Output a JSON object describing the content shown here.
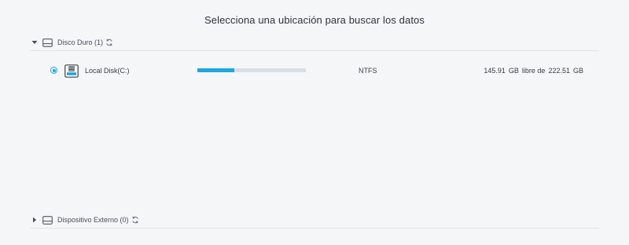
{
  "title": "Selecciona una ubicación para buscar los datos",
  "sections": [
    {
      "label": "Disco Duro (1)",
      "expanded": true,
      "drives": [
        {
          "name": "Local Disk(C:)",
          "selected": true,
          "filesystem": "NTFS",
          "free": "145.91",
          "free_unit": "GB",
          "free_label": "libre de",
          "total": "222.51",
          "total_unit": "GB",
          "used_fraction": 0.344
        }
      ]
    },
    {
      "label": "Dispositivo Externo (0)",
      "expanded": false,
      "drives": []
    }
  ],
  "colors": {
    "accent": "#1fa2de",
    "progress_track": "#dadde2",
    "background": "#f5f6f8"
  },
  "icons": {
    "expand_open": "chevron-down-icon",
    "expand_closed": "chevron-right-icon",
    "drive": "hard-drive-icon",
    "refresh": "refresh-icon",
    "disk": "local-disk-icon"
  }
}
